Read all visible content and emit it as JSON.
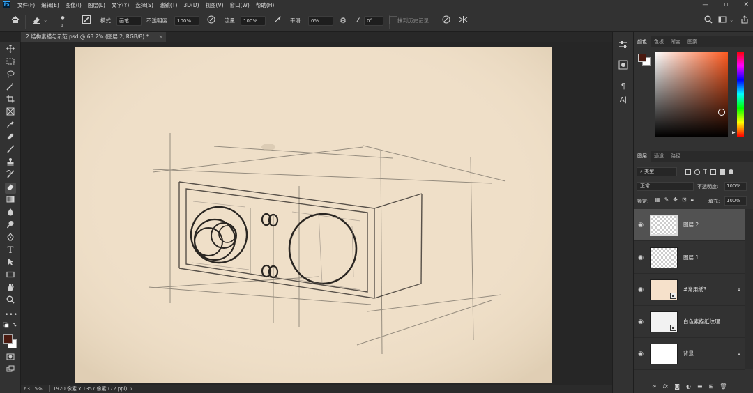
{
  "app": {
    "logo": "Ps"
  },
  "menu": [
    "文件(F)",
    "编辑(E)",
    "图像(I)",
    "图层(L)",
    "文字(Y)",
    "选择(S)",
    "滤镜(T)",
    "3D(D)",
    "视图(V)",
    "窗口(W)",
    "帮助(H)"
  ],
  "window_controls": [
    "—",
    "▫",
    "✕"
  ],
  "options": {
    "brush_size": "9",
    "mode_label": "模式:",
    "mode_value": "画笔",
    "opacity_label": "不透明度:",
    "opacity_value": "100%",
    "flow_label": "流量:",
    "flow_value": "100%",
    "smoothing_label": "平滑:",
    "smoothing_value": "0%",
    "angle_value": "0°",
    "erase_history_label": "抹到历史记录"
  },
  "document": {
    "tab_title": "2 结构素描与示范.psd @ 63.2% (图层 2, RGB/8) *",
    "tab_close": "×"
  },
  "status": {
    "zoom": "63.15%",
    "info": "1920 像素 x 1357 像素 (72 ppi)",
    "arrow": "›"
  },
  "dock": {
    "paragraph_icon_glyph": "¶",
    "character_icon_glyph": "A|"
  },
  "color_panel": {
    "tabs": [
      "颜色",
      "色板",
      "渐变",
      "图案"
    ],
    "foreground": "#4a1a10",
    "background": "#ffffff",
    "picker_hue": "#ff5a1f"
  },
  "layers_panel": {
    "tabs": [
      "图层",
      "通道",
      "路径"
    ],
    "filter_label": "类型",
    "blend_mode": "正常",
    "opacity_label": "不透明度:",
    "opacity_value": "100%",
    "lock_label": "锁定:",
    "fill_label": "填充:",
    "fill_value": "100%",
    "layers": [
      {
        "name": "图层 2",
        "selected": true,
        "locked": false
      },
      {
        "name": "图层 1",
        "selected": false,
        "locked": false
      },
      {
        "name": "#常用纸3",
        "selected": false,
        "locked": true
      },
      {
        "name": "白色素描纸纹理",
        "selected": false,
        "locked": false
      },
      {
        "name": "背景",
        "selected": false,
        "locked": true
      }
    ],
    "bottom_icons": [
      "link-icon",
      "fx-icon",
      "mask-icon",
      "adjustment-icon",
      "group-icon",
      "new-layer-icon",
      "trash-icon"
    ],
    "fx_glyph": "fx"
  },
  "colors": {
    "paper": "#efdfc8",
    "ui_dark": "#323232",
    "canvas_bg": "#262626",
    "pencil": "#2a2622",
    "accent_blue": "#31a8ff"
  }
}
